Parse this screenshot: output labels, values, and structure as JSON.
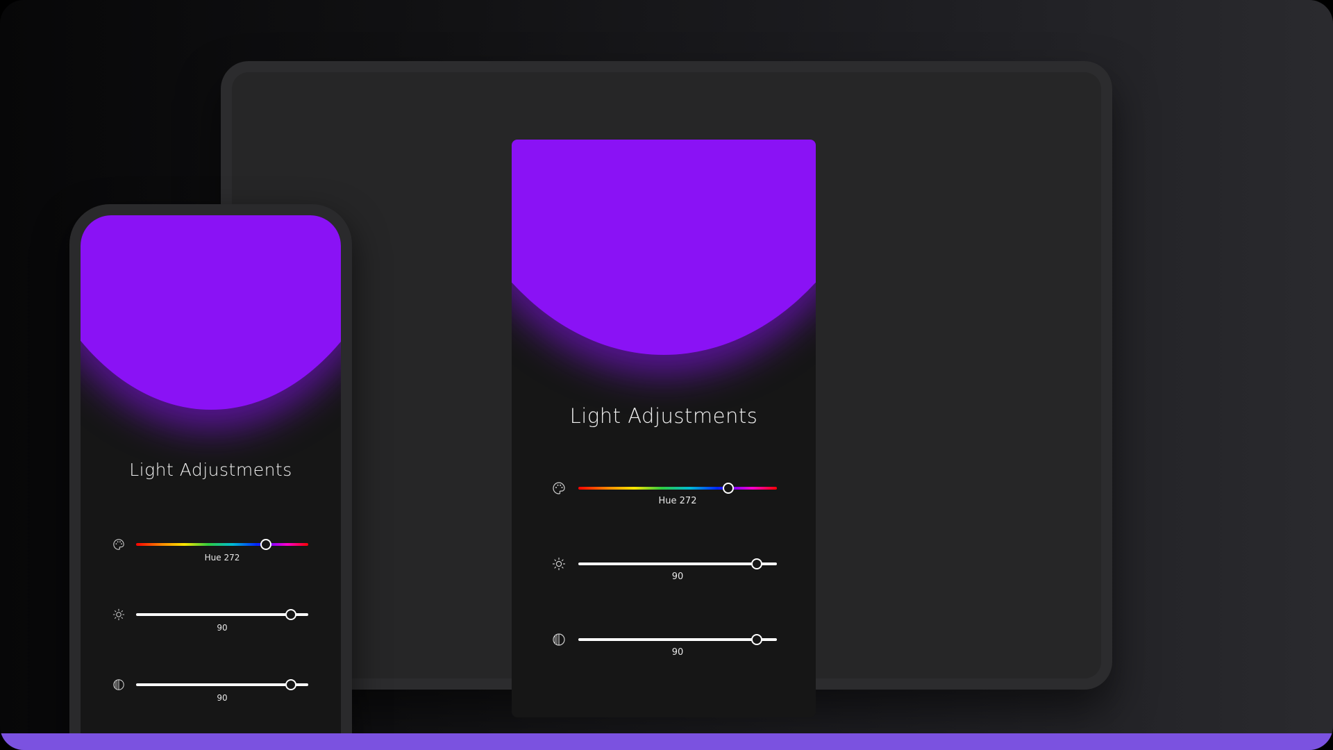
{
  "colors": {
    "accent": "#8a12f5",
    "bottom_bar": "#7b52e0",
    "panel_bg": "#161616"
  },
  "tablet": {
    "title": "Light Adjustments",
    "hue": {
      "icon": "palette-icon",
      "label": "Hue 272",
      "value": 272,
      "max": 360
    },
    "brightness": {
      "icon": "sun-icon",
      "label": "90",
      "value": 90,
      "max": 100
    },
    "contrast": {
      "icon": "contrast-icon",
      "label": "90",
      "value": 90,
      "max": 100
    }
  },
  "phone": {
    "title": "Light Adjustments",
    "hue": {
      "icon": "palette-icon",
      "label": "Hue 272",
      "value": 272,
      "max": 360
    },
    "brightness": {
      "icon": "sun-icon",
      "label": "90",
      "value": 90,
      "max": 100
    },
    "contrast": {
      "icon": "contrast-icon",
      "label": "90",
      "value": 90,
      "max": 100
    }
  }
}
